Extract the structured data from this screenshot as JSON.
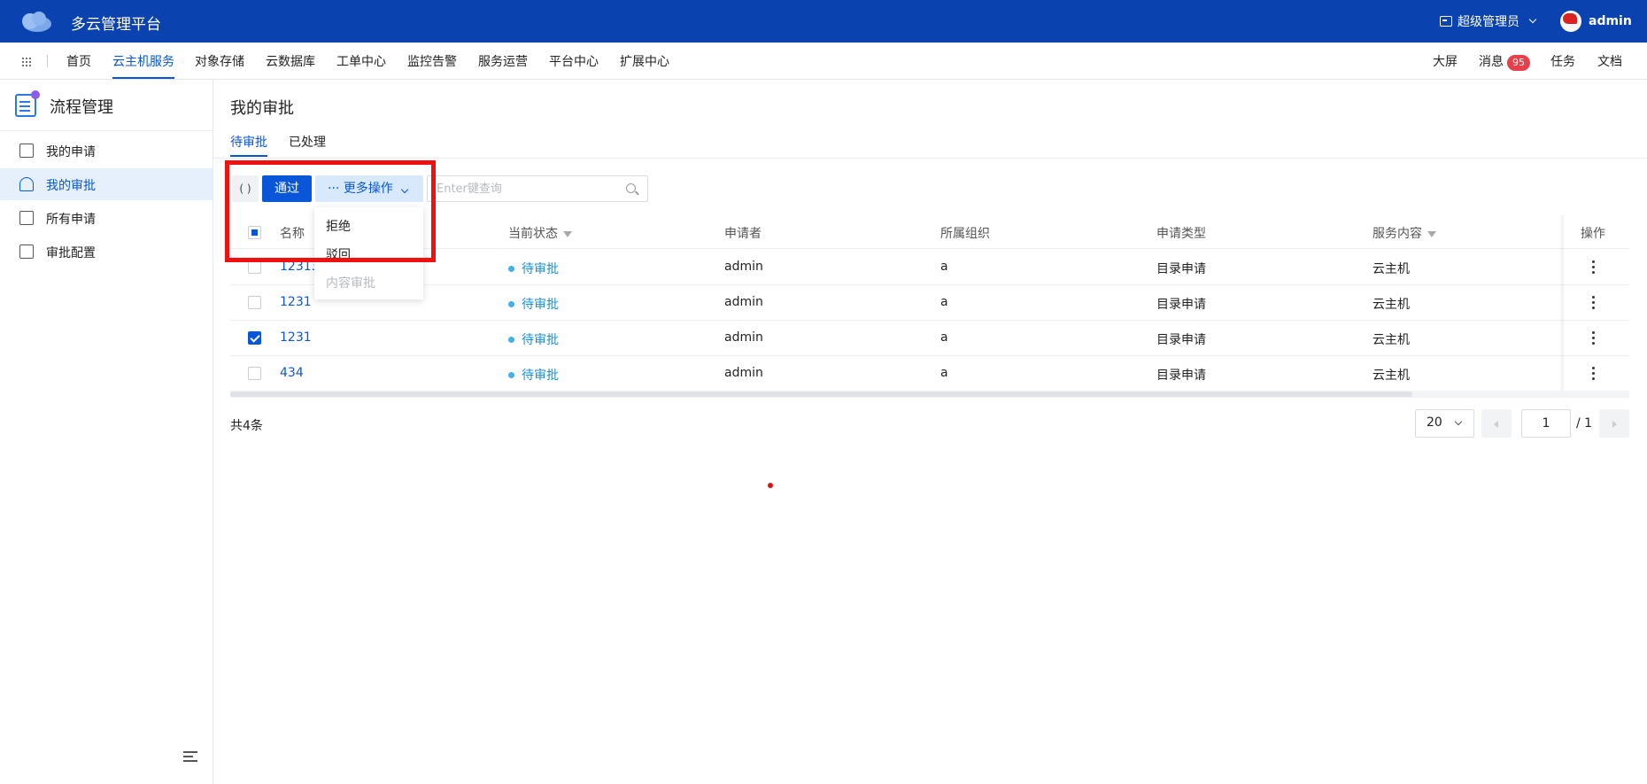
{
  "app": {
    "title": "多云管理平台",
    "role": "超级管理员",
    "username": "admin"
  },
  "nav": {
    "items": [
      "首页",
      "云主机服务",
      "对象存储",
      "云数据库",
      "工单中心",
      "监控告警",
      "服务运营",
      "平台中心",
      "扩展中心"
    ],
    "active": "云主机服务",
    "right": {
      "screen": "大屏",
      "messages": "消息",
      "message_count": "95",
      "tasks": "任务",
      "docs": "文档"
    }
  },
  "sidebar": {
    "title": "流程管理",
    "items": [
      "我的申请",
      "我的审批",
      "所有申请",
      "审批配置"
    ],
    "active": "我的审批"
  },
  "page": {
    "title": "我的审批",
    "tabs": [
      "待审批",
      "已处理"
    ],
    "active_tab": "待审批"
  },
  "toolbar": {
    "refresh": "( )",
    "pass": "通过",
    "more": "更多操作",
    "search_placeholder": "Enter键查询"
  },
  "dropdown": {
    "items": [
      {
        "label": "拒绝",
        "disabled": false
      },
      {
        "label": "驳回",
        "disabled": false
      },
      {
        "label": "内容审批",
        "disabled": true
      }
    ]
  },
  "table": {
    "columns": [
      "名称",
      "当前状态",
      "申请者",
      "所属组织",
      "申请类型",
      "服务内容",
      "操作"
    ],
    "rows": [
      {
        "name": "12313",
        "status": "待审批",
        "applicant": "admin",
        "org": "a",
        "type": "目录申请",
        "service": "云主机",
        "checked": false
      },
      {
        "name": "1231",
        "status": "待审批",
        "applicant": "admin",
        "org": "a",
        "type": "目录申请",
        "service": "云主机",
        "checked": false
      },
      {
        "name": "1231",
        "status": "待审批",
        "applicant": "admin",
        "org": "a",
        "type": "目录申请",
        "service": "云主机",
        "checked": true
      },
      {
        "name": "434",
        "status": "待审批",
        "applicant": "admin",
        "org": "a",
        "type": "目录申请",
        "service": "云主机",
        "checked": false
      }
    ]
  },
  "pagination": {
    "total": "共4条",
    "page_size": "20",
    "current_page": "1",
    "total_pages": "/ 1"
  },
  "colors": {
    "header": "#0a43b0",
    "accent": "#0a56d8",
    "annotation": "#f01010"
  }
}
